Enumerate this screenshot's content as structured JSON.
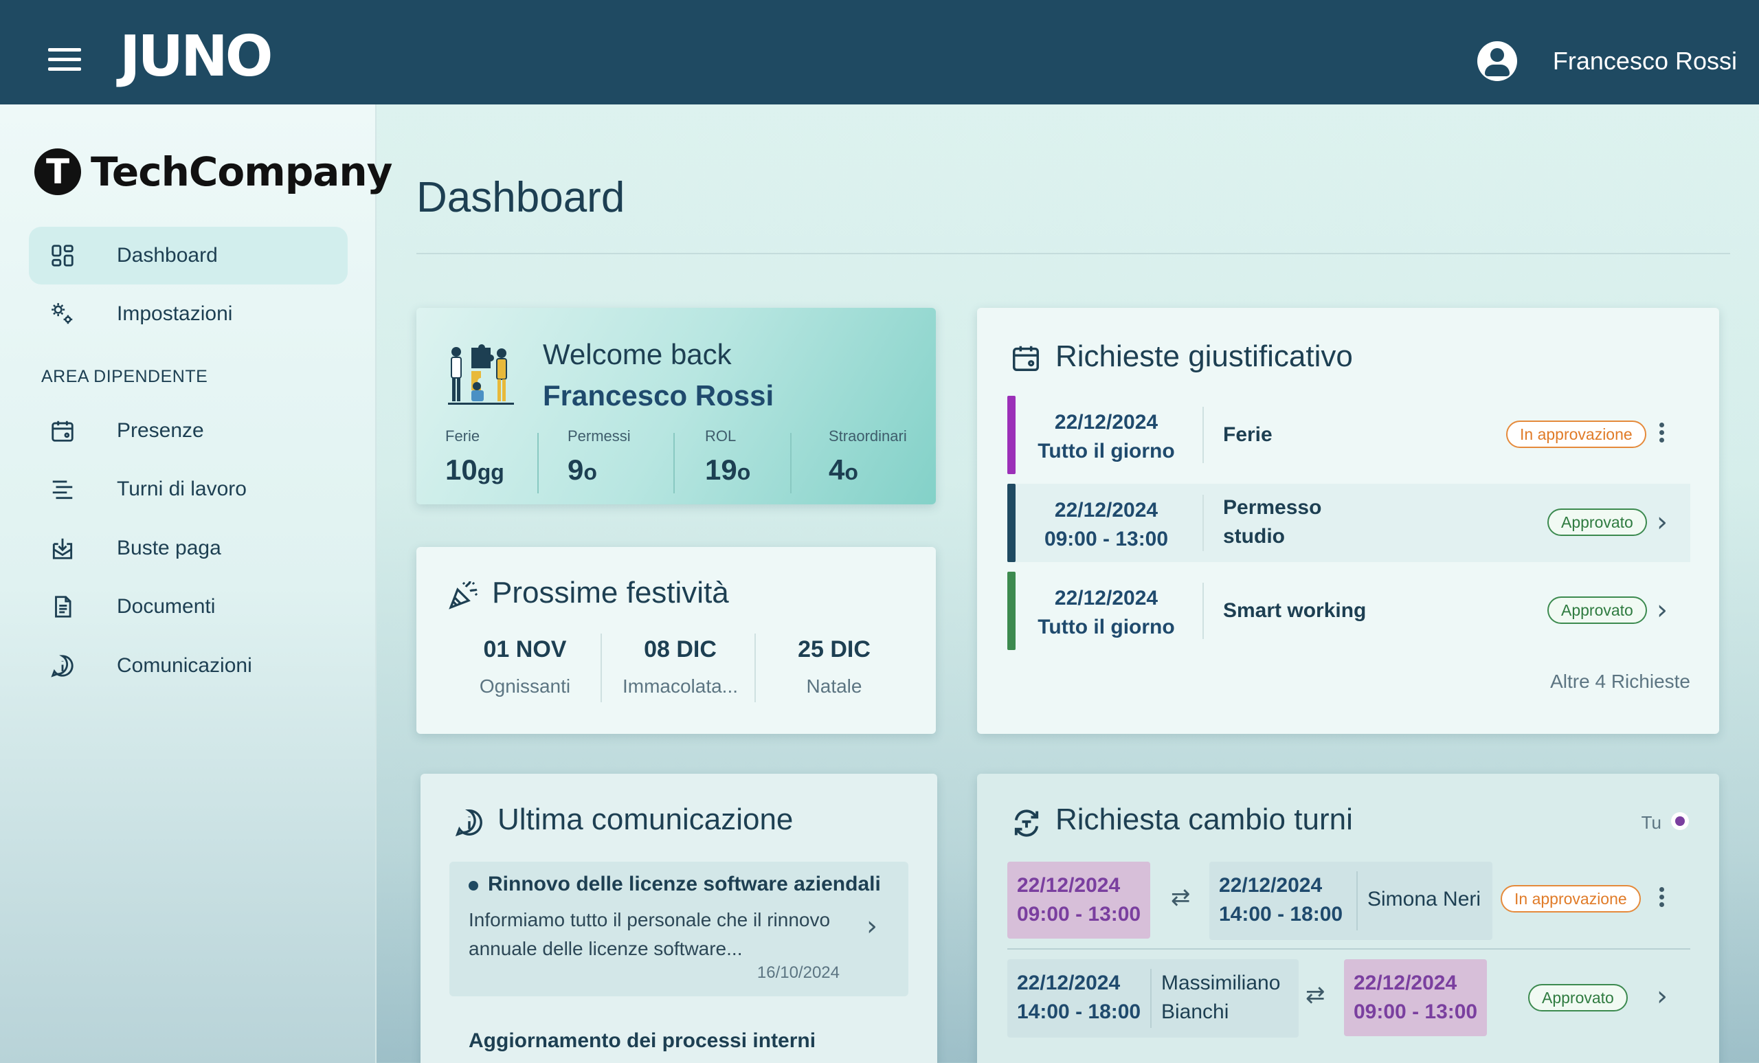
{
  "app": {
    "name": "Juno",
    "logo_text": "JUNO"
  },
  "header": {
    "user_name": "Francesco Rossi"
  },
  "sidebar": {
    "company": "TechCompany",
    "company_initial": "T",
    "items": [
      {
        "label": "Dashboard",
        "icon": "dashboard-icon",
        "active": true
      },
      {
        "label": "Impostazioni",
        "icon": "settings-icon",
        "active": false
      }
    ],
    "section_label": "AREA DIPENDENTE",
    "employee_items": [
      {
        "label": "Presenze",
        "icon": "calendar-icon"
      },
      {
        "label": "Turni di lavoro",
        "icon": "shifts-icon"
      },
      {
        "label": "Buste paga",
        "icon": "payslip-icon"
      },
      {
        "label": "Documenti",
        "icon": "document-icon"
      },
      {
        "label": "Comunicazioni",
        "icon": "info-icon"
      }
    ]
  },
  "main": {
    "title": "Dashboard"
  },
  "welcome": {
    "greeting": "Welcome back",
    "name": "Francesco Rossi",
    "stats": [
      {
        "label": "Ferie",
        "value": "10",
        "unit": "gg"
      },
      {
        "label": "Permessi",
        "value": "9",
        "unit": "o"
      },
      {
        "label": "ROL",
        "value": "19",
        "unit": "o"
      },
      {
        "label": "Straordinari",
        "value": "4",
        "unit": "o"
      }
    ]
  },
  "holidays": {
    "title": "Prossime festività",
    "items": [
      {
        "date": "01 NOV",
        "name": "Ognissanti"
      },
      {
        "date": "08 DIC",
        "name": "Immacolata..."
      },
      {
        "date": "25 DIC",
        "name": "Natale"
      }
    ]
  },
  "requests": {
    "title": "Richieste giustificativo",
    "items": [
      {
        "date": "22/12/2024",
        "time": "Tutto il giorno",
        "type": "Ferie",
        "status": "In approvazione",
        "color": "#9b30b8"
      },
      {
        "date": "22/12/2024",
        "time": "09:00 - 13:00",
        "type": "Permesso studio",
        "status": "Approvato",
        "color": "#1f4a62"
      },
      {
        "date": "22/12/2024",
        "time": "Tutto il giorno",
        "type": "Smart working",
        "status": "Approvato",
        "color": "#3c8a4f"
      }
    ],
    "more": "Altre 4 Richieste"
  },
  "communication": {
    "title": "Ultima comunicazione",
    "subject": "Rinnovo delle licenze software aziendali",
    "body": "Informiamo tutto il personale che il rinnovo annuale delle licenze software...",
    "date": "16/10/2024",
    "next_subject": "Aggiornamento dei processi interni"
  },
  "shift_change": {
    "title": "Richiesta cambio turni",
    "legend": "Tu",
    "rows": [
      {
        "mine_date": "22/12/2024",
        "mine_time": "09:00 - 13:00",
        "other_date": "22/12/2024",
        "other_time": "14:00 - 18:00",
        "person": "Simona Neri",
        "status": "In approvazione"
      },
      {
        "other_date": "22/12/2024",
        "other_time": "14:00 - 18:00",
        "person_first": "Massimiliano",
        "person_last": "Bianchi",
        "mine_date": "22/12/2024",
        "mine_time": "09:00 - 13:00",
        "status": "Approvato"
      }
    ]
  },
  "colors": {
    "header": "#1f4a62",
    "accent": "#1f4a6d",
    "pending": "#e07b28",
    "approved": "#2f7b40",
    "mine": "#7a3f9f"
  }
}
